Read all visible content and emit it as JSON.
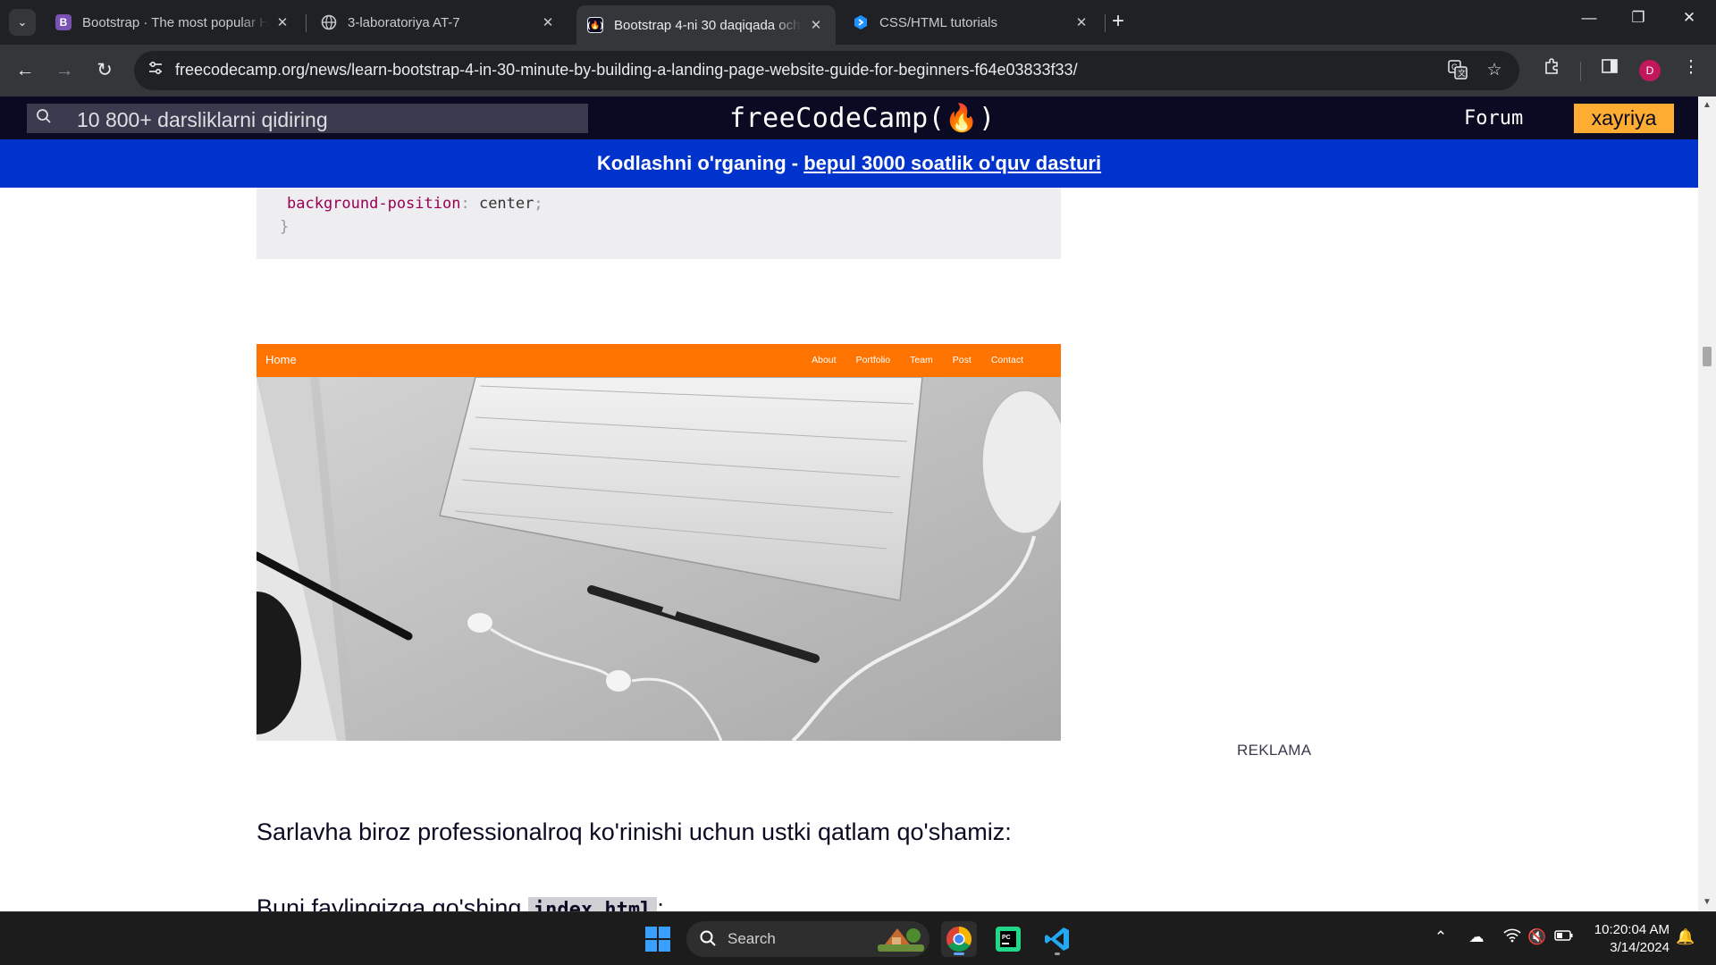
{
  "browser": {
    "tabs": [
      {
        "title": "Bootstrap · The most popular H",
        "favicon": "bootstrap-icon",
        "close": "✕"
      },
      {
        "title": "3-laboratoriya AT-7",
        "favicon": "globe-icon",
        "close": "✕"
      },
      {
        "title": "Bootstrap 4-ni 30 daqiqada och",
        "favicon": "freecodecamp-icon",
        "close": "✕",
        "active": true
      },
      {
        "title": "CSS/HTML tutorials",
        "favicon": "vscode-tutorials-icon",
        "close": "✕"
      }
    ],
    "new_tab": "+",
    "url": "freecodecamp.org/news/learn-bootstrap-4-in-30-minute-by-building-a-landing-page-website-guide-for-beginners-f64e03833f33/",
    "profile_initial": "D"
  },
  "page": {
    "nav": {
      "search_placeholder": "10 800+ darsliklarni qidiring",
      "logo": "freeCodeCamp(🔥)",
      "forum": "Forum",
      "donate": "xayriya"
    },
    "banner": {
      "text": "Kodlashni o'rganing - ",
      "link": "bepul 3000 soatlik o'quv dasturi"
    },
    "code": {
      "property": "background-position",
      "value": "center",
      "closing_brace": "}"
    },
    "hero": {
      "home": "Home",
      "links": [
        "About",
        "Portfolio",
        "Team",
        "Post",
        "Contact"
      ]
    },
    "ad_label": "REKLAMA",
    "paragraph": "Sarlavha biroz professionalroq ko'rinishi uchun ustki qatlam qo'shamiz:",
    "paragraph2_text": "Buni faylingizga qo'shing ",
    "paragraph2_code": "index.html",
    "paragraph2_tail": ":"
  },
  "taskbar": {
    "search_label": "Search",
    "time": "10:20:04 AM",
    "date": "3/14/2024"
  },
  "colors": {
    "fcc_navy": "#0a0a23",
    "banner_blue": "#0033cc",
    "donate_yellow": "#feac32",
    "hero_orange": "#ff7400"
  }
}
